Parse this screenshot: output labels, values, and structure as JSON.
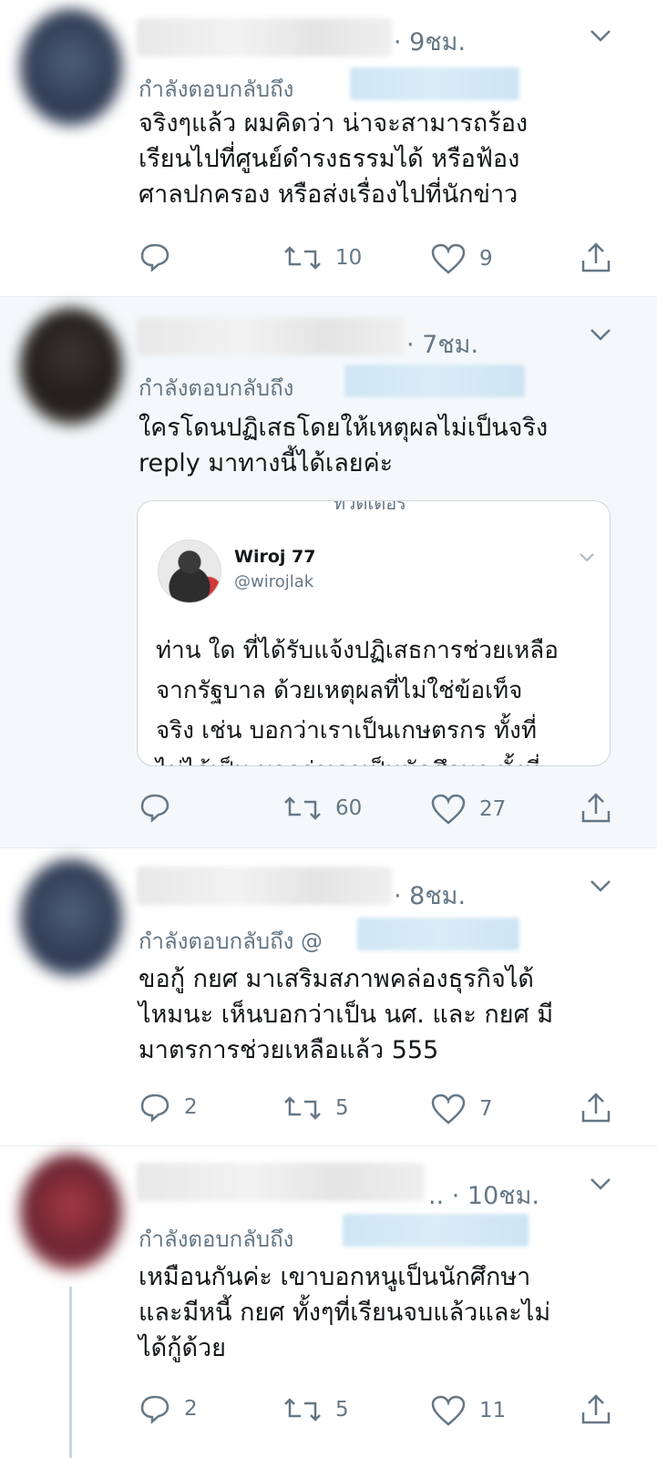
{
  "tweets": [
    {
      "time": "· 9ชม.",
      "reply_prefix": "กำลังตอบกลับถึง",
      "text": "จริงๆแล้ว ผมคิดว่า น่าจะสามารถร้อง\nเรียนไปที่ศูนย์ดำรงธรรมได้ หรือฟ้อง\nศาลปกครอง หรือส่งเรื่องไปที่นักข่าว",
      "actions": {
        "reply": "",
        "retweet": "10",
        "like": "9"
      }
    },
    {
      "time": "· 7ชม.",
      "reply_prefix": "กำลังตอบกลับถึง",
      "text": "ใครโดนปฏิเสธโดยให้เหตุผลไม่เป็นจริง\nreply มาทางนี้ได้เลยค่ะ",
      "quote": {
        "name": "Wiroj 77",
        "handle": "@wirojlak",
        "text": "ท่าน ใด ที่ได้รับแจ้งปฏิเสธการช่วยเหลือ\nจากรัฐบาล ด้วยเหตุผลที่ไม่ใช่ข้อเท็จ\nจริง เช่น บอกว่าเราเป็นเกษตรกร ทั้งที่",
        "cut_line": "ไม่ได้เป็น บอกว่าเราเป็นนักศึกษา ทั้งที่",
        "top_fragment": "ทวิตเตอร์"
      },
      "actions": {
        "reply": "",
        "retweet": "60",
        "like": "27"
      }
    },
    {
      "time": "· 8ชม.",
      "reply_prefix": "กำลังตอบกลับถึง @",
      "text": "ขอกู้ กยศ มาเสริมสภาพคล่องธุรกิจได้\nไหมนะ เห็นบอกว่าเป็น นศ. และ กยศ มี\nมาตรการช่วยเหลือแล้ว 555",
      "actions": {
        "reply": "2",
        "retweet": "5",
        "like": "7"
      }
    },
    {
      "time": ".. · 10ชม.",
      "reply_prefix": "กำลังตอบกลับถึง",
      "text": "เหมือนกันค่ะ เขาบอกหนูเป็นนักศึกษา\nและมีหนี้ กยศ ทั้งๆที่เรียนจบแล้วและไม่\nได้กู้ด้วย",
      "actions": {
        "reply": "2",
        "retweet": "5",
        "like": "11"
      }
    }
  ],
  "colors": {
    "muted": "#657786",
    "text": "#14171a",
    "shaded_bg": "#f5f8fa",
    "handle_blur": "#cfe6f5"
  }
}
